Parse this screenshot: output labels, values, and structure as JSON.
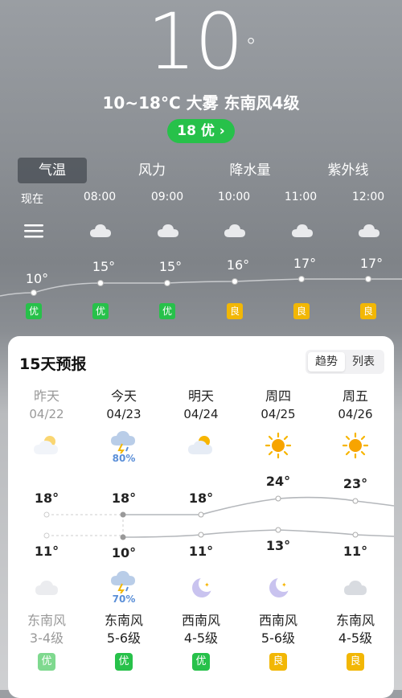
{
  "current": {
    "temperature": "10",
    "degree_symbol": "°",
    "summary": "10~18°C 大雾 东南风4级",
    "aqi_label": "18 优 ›"
  },
  "tabs": [
    "气温",
    "风力",
    "降水量",
    "紫外线"
  ],
  "hourly": [
    {
      "time": "现在",
      "icon": "fog-icon",
      "temp": "10°",
      "temp_value": 10,
      "aq": "优",
      "aq_level": "good"
    },
    {
      "time": "08:00",
      "icon": "cloud-icon",
      "temp": "15°",
      "temp_value": 15,
      "aq": "优",
      "aq_level": "good"
    },
    {
      "time": "09:00",
      "icon": "cloud-icon",
      "temp": "15°",
      "temp_value": 15,
      "aq": "优",
      "aq_level": "good"
    },
    {
      "time": "10:00",
      "icon": "cloud-icon",
      "temp": "16°",
      "temp_value": 16,
      "aq": "良",
      "aq_level": "moderate"
    },
    {
      "time": "11:00",
      "icon": "cloud-icon",
      "temp": "17°",
      "temp_value": 17,
      "aq": "良",
      "aq_level": "moderate"
    },
    {
      "time": "12:00",
      "icon": "cloud-icon",
      "temp": "17°",
      "temp_value": 17,
      "aq": "良",
      "aq_level": "moderate"
    }
  ],
  "forecast": {
    "title": "15天预报",
    "toggle_trend": "趋势",
    "toggle_list": "列表",
    "days": [
      {
        "name": "昨天",
        "date": "04/22",
        "day_icon": "partly-sunny-icon",
        "night_icon": "cloud-icon",
        "high": "18°",
        "low": "11°",
        "wind_dir": "东南风",
        "wind_level": "3-4级",
        "aq": "优",
        "aq_level": "good",
        "past": true
      },
      {
        "name": "今天",
        "date": "04/23",
        "day_icon": "thunder-rain-icon",
        "precip_day": "80%",
        "night_icon": "thunder-rain-icon",
        "precip_night": "70%",
        "high": "18°",
        "low": "10°",
        "wind_dir": "东南风",
        "wind_level": "5-6级",
        "aq": "优",
        "aq_level": "good"
      },
      {
        "name": "明天",
        "date": "04/24",
        "day_icon": "partly-sunny-icon",
        "night_icon": "moon-icon",
        "high": "18°",
        "low": "11°",
        "wind_dir": "西南风",
        "wind_level": "4-5级",
        "aq": "优",
        "aq_level": "good"
      },
      {
        "name": "周四",
        "date": "04/25",
        "day_icon": "sun-icon",
        "night_icon": "moon-icon",
        "high": "24°",
        "low": "13°",
        "wind_dir": "西南风",
        "wind_level": "5-6级",
        "aq": "良",
        "aq_level": "moderate"
      },
      {
        "name": "周五",
        "date": "04/26",
        "day_icon": "sun-icon",
        "night_icon": "cloud-icon",
        "high": "23°",
        "low": "11°",
        "wind_dir": "东南风",
        "wind_level": "4-5级",
        "aq": "良",
        "aq_level": "moderate"
      }
    ]
  },
  "colors": {
    "good": "#27c14a",
    "moderate": "#f2b705"
  }
}
